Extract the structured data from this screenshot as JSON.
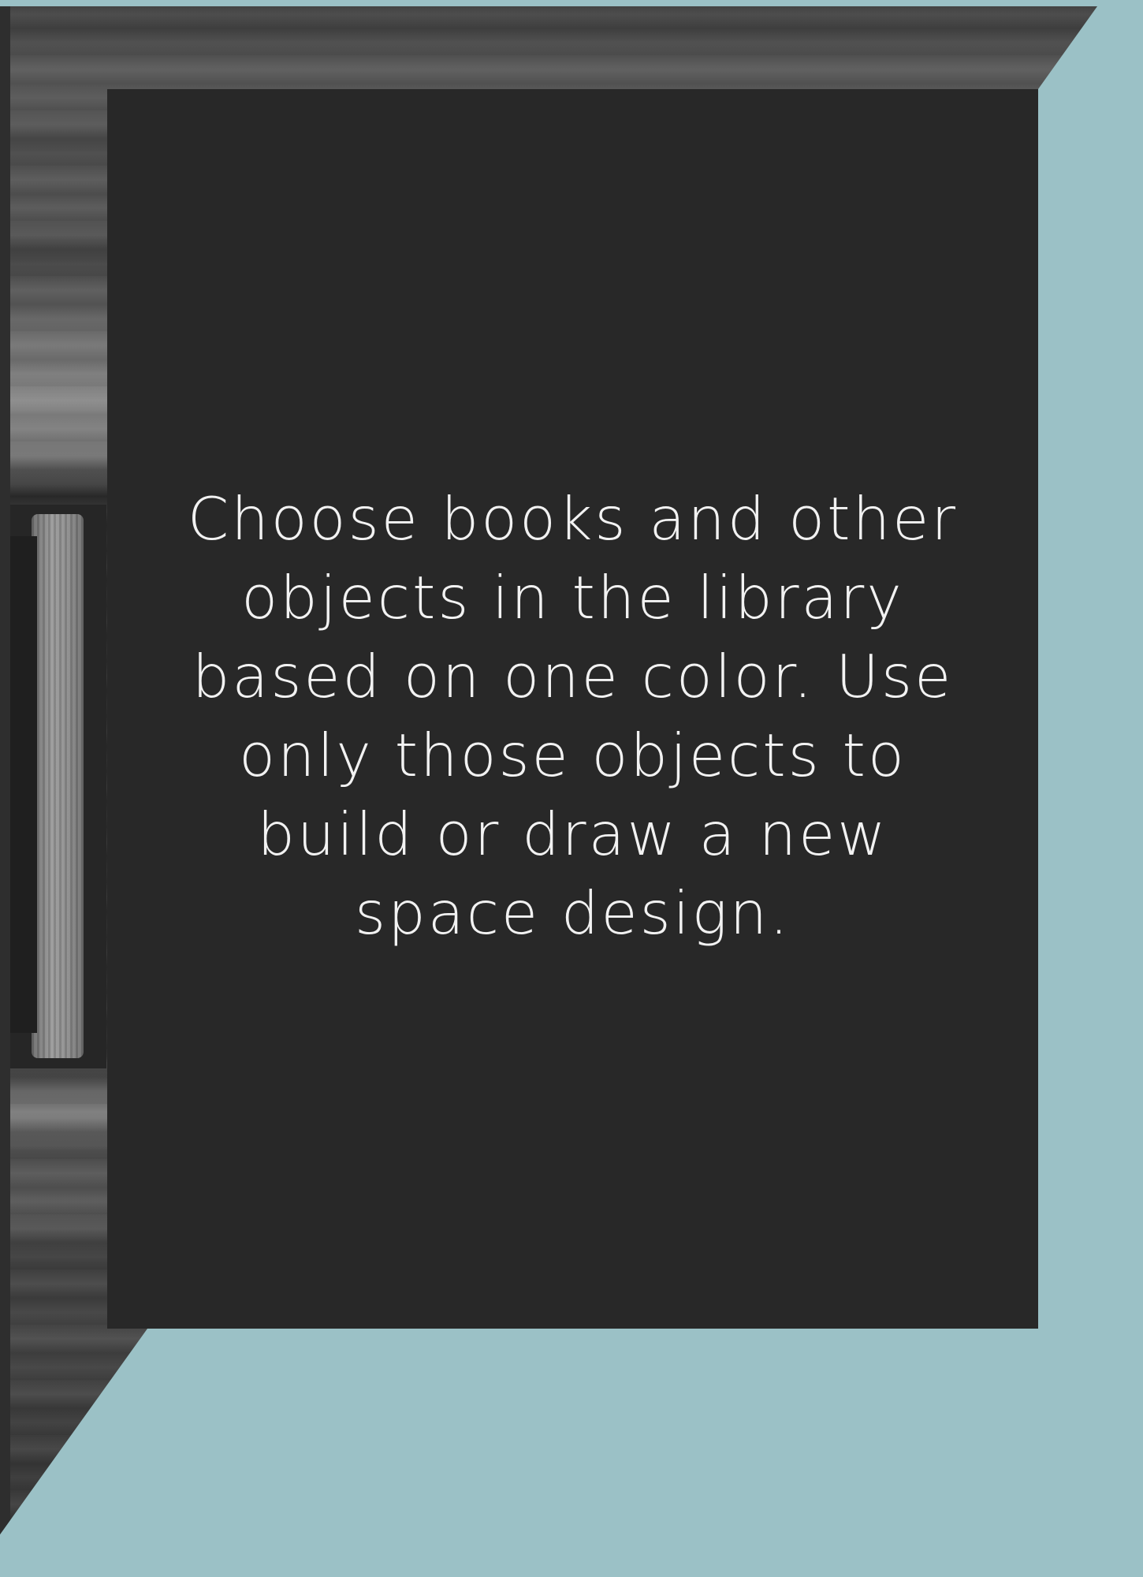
{
  "background": {
    "color": "#9bc1c6"
  },
  "photo": {
    "subject": "library-shelf"
  },
  "card": {
    "color": "#282828",
    "text_color": "#f2f2f2",
    "text": "Choose books and other objects in the library based on one color. Use only those objects to build or draw a new space design."
  }
}
